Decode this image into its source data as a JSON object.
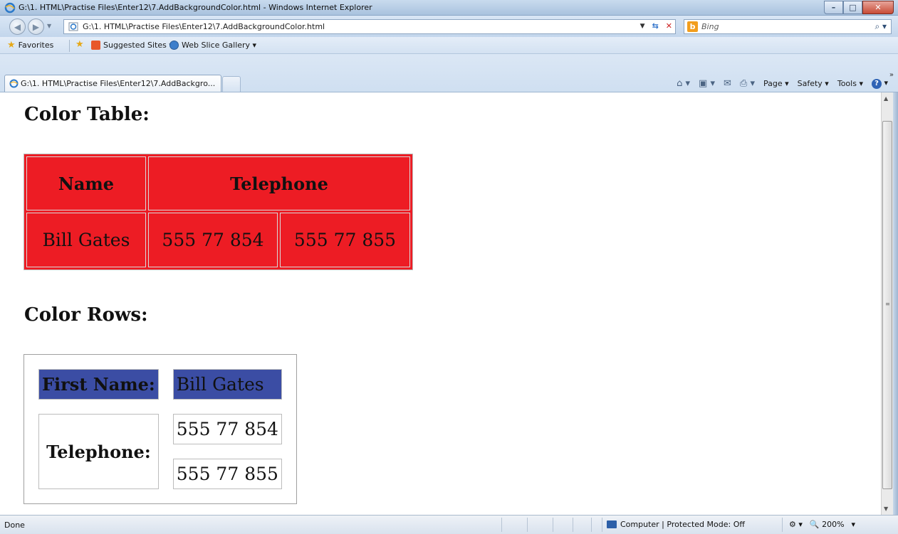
{
  "window": {
    "title": "G:\\1. HTML\\Practise Files\\Enter12\\7.AddBackgroundColor.html - Windows Internet Explorer",
    "minimize_label": "–",
    "maximize_label": "□",
    "close_label": "✕"
  },
  "address_bar": {
    "url": "G:\\1. HTML\\Practise Files\\Enter12\\7.AddBackgroundColor.html",
    "search_placeholder": "Bing"
  },
  "favorites_bar": {
    "favorites_label": "Favorites",
    "suggested_sites_label": "Suggested Sites ▾",
    "web_slice_label": "Web Slice Gallery ▾"
  },
  "tab": {
    "label": "G:\\1. HTML\\Practise Files\\Enter12\\7.AddBackgro..."
  },
  "command_bar": {
    "page_label": "Page ▾",
    "safety_label": "Safety ▾",
    "tools_label": "Tools ▾"
  },
  "page": {
    "color_table_heading": "Color Table:",
    "color_table": {
      "header_name": "Name",
      "header_telephone": "Telephone",
      "name": "Bill Gates",
      "phone1": "555 77 854",
      "phone2": "555 77 855",
      "background": "#ed1c24"
    },
    "color_rows_heading": "Color Rows:",
    "color_rows": {
      "first_name_label": "First Name:",
      "first_name_value": "Bill Gates",
      "telephone_label": "Telephone:",
      "phone1": "555 77 854",
      "phone2": "555 77 855",
      "row_background": "#3b4da4"
    }
  },
  "status_bar": {
    "status": "Done",
    "zone": "Computer | Protected Mode: Off",
    "zoom": "200%"
  }
}
